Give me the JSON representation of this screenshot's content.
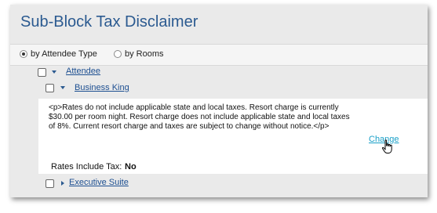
{
  "title": "Sub-Block Tax Disclaimer",
  "view_options": [
    {
      "label": "by Attendee Type",
      "selected": true
    },
    {
      "label": "by Rooms",
      "selected": false
    }
  ],
  "tree": {
    "attendee": {
      "label": "Attendee",
      "checked": false,
      "expanded": true
    },
    "business_king": {
      "label": "Business King",
      "checked": false,
      "expanded": true
    },
    "executive_suite": {
      "label": "Executive Suite",
      "checked": false,
      "expanded": false
    }
  },
  "detail": {
    "disclaimer_text": "<p>Rates do not include applicable state and local taxes. Resort charge is currently $30.00 per room night. Resort charge does not include applicable state and local taxes of 8%. Current resort charge and taxes are subject to change without notice.</p>",
    "change_label": "Change",
    "rates_include_tax_label": "Rates Include Tax:",
    "rates_include_tax_value": "No"
  },
  "colors": {
    "title": "#2b5a90",
    "link": "#1d4f91",
    "change_link": "#1aa0c8",
    "panel_bg": "#eaeaea"
  }
}
